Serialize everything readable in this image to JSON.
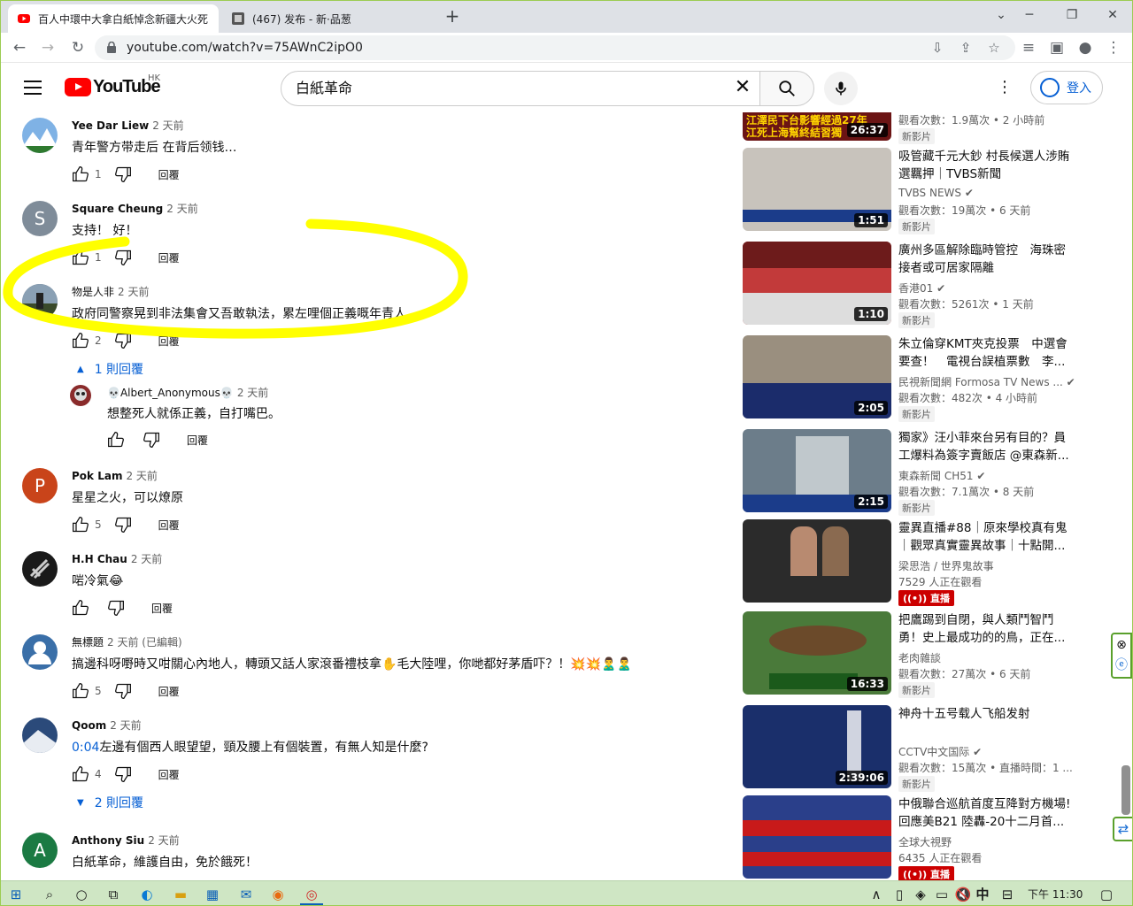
{
  "browser": {
    "tabs": [
      {
        "title": "百人中環中大拿白紙悼念新疆大火死",
        "close": "×"
      },
      {
        "title": "(467) 发布 - 新·品葱",
        "close": "×"
      }
    ],
    "new_tab": "+",
    "url": "youtube.com/watch?v=75AWnC2ipO0"
  },
  "yt": {
    "logo_text": "YouTube",
    "region": "HK",
    "search_query": "白紙革命",
    "signin_label": "登入"
  },
  "comments": [
    {
      "author": "Yee Dar Liew",
      "time": "2 天前",
      "text": "青年警方带走后 在背后领钱…",
      "likes": "1",
      "reply": "回覆",
      "avatar_color": "#7fb2e5"
    },
    {
      "author": "Square Cheung",
      "time": "2 天前",
      "text": "支持！ 好！",
      "likes": "1",
      "reply": "回覆",
      "avatar_letter": "S",
      "avatar_color": "#7f8c99"
    },
    {
      "author": "物是人非",
      "time": "2 天前",
      "text": "政府同警察晃到非法集會又吾敢執法，累左哩個正義嘅年青人。",
      "likes": "2",
      "reply": "回覆",
      "avatar_color": "#4f5f6f",
      "replies_label": "1 則回覆"
    },
    {
      "author": "💀Albert_Anonymous💀",
      "time": "2 天前",
      "text": "想整死人就係正義，自打嘴巴。",
      "likes": "",
      "reply": "回覆",
      "avatar_color": "#8a2b2b"
    },
    {
      "author": "Pok Lam",
      "time": "2 天前",
      "text": "星星之火，可以燎原",
      "likes": "5",
      "reply": "回覆",
      "avatar_letter": "P",
      "avatar_color": "#c9441a"
    },
    {
      "author": "H.H Chau",
      "time": "2 天前",
      "text": "啱冷氣😂",
      "likes": "",
      "reply": "回覆",
      "avatar_color": "#1a1a1a"
    },
    {
      "author": "無標題",
      "time": "2 天前 (已編輯)",
      "text": "搞邊科呀嘢時又咁關心內地人，轉頭又話人家滾番禮枝拿✋毛大陸哩，你哋都好茅盾吓？！💥💥🙎‍♂️🙎‍♂️",
      "likes": "5",
      "reply": "回覆",
      "avatar_color": "#3a6fa8"
    },
    {
      "author": "Qoom",
      "time": "2 天前",
      "timestamp_link": "0:04",
      "text": "左邊有個西人眼望望，頸及腰上有個裝置，有無人知是什麼?",
      "likes": "4",
      "reply": "回覆",
      "avatar_color": "#2b4a7a",
      "replies_label": "2 則回覆"
    },
    {
      "author": "Anthony Siu",
      "time": "2 天前",
      "text": "白紙革命，維護自由，免於餓死！",
      "likes": "",
      "reply": "回覆",
      "avatar_letter": "A",
      "avatar_color": "#1b7a43"
    }
  ],
  "sidebar": [
    {
      "title": "",
      "duration": "26:37",
      "views": "觀看次數：1.9萬次 • 2 小時前",
      "channel": "",
      "badge": "新影片",
      "thumb_text": "江澤民下台影響經過27年\n江死上海幫終結習獨",
      "thumb_color": "#6b1414"
    },
    {
      "title": "吸管藏千元大鈔 村長候選人涉賄選羈押｜TVBS新聞",
      "duration": "1:51",
      "channel": "TVBS NEWS",
      "views": "觀看次數：19萬次 • 6 天前",
      "badge": "新影片",
      "thumb_color": "#c8c3bc"
    },
    {
      "title": "廣州多區解除臨時管控　海珠密接者或可居家隔離",
      "duration": "1:10",
      "channel": "香港01",
      "views": "觀看次數：5261次 • 1 天前",
      "badge": "新影片",
      "thumb_color": "#c23a3a"
    },
    {
      "title": "朱立倫穿KMT夾克投票　中選會要查！　電視台誤植票數　李...",
      "duration": "2:05",
      "channel": "民視新聞網 Formosa TV News ...",
      "views": "觀看次數：482次 • 4 小時前",
      "badge": "新影片",
      "thumb_color": "#9a8f7f"
    },
    {
      "title": "獨家》汪小菲來台另有目的？員工爆料為簽字賣飯店 @東森新...",
      "duration": "2:15",
      "channel": "東森新聞 CH51",
      "views": "觀看次數：7.1萬次 • 8 天前",
      "badge": "新影片",
      "thumb_color": "#6c7d8a"
    },
    {
      "title": "靈異直播#88｜原來學校真有鬼｜觀眾真實靈異故事｜十點開...",
      "duration": "",
      "channel": "梁思浩 / 世界鬼故事",
      "views": "7529 人正在觀看",
      "live_label": "直播",
      "thumb_color": "#2b2b2b"
    },
    {
      "title": "把鷹踢到自閉，與人類鬥智鬥勇！史上最成功的的鳥，正在...",
      "duration": "16:33",
      "channel": "老肉雜談",
      "views": "觀看次數：27萬次 • 6 天前",
      "badge": "新影片",
      "thumb_color": "#4a7a3a"
    },
    {
      "title": "神舟十五号载人飞船发射",
      "duration": "2:39:06",
      "channel": "CCTV中文国际",
      "views": "觀看次數：15萬次 • 直播時間：1 ...",
      "badge": "新影片",
      "thumb_color": "#1a2f6b"
    },
    {
      "title": "中俄聯合巡航首度互降對方機場!回應美B21 陸轟-20十二月首...",
      "duration": "",
      "channel": "全球大視野",
      "views": "6435 人正在觀看",
      "live_label": "直播",
      "thumb_color": "#2a3f8a"
    }
  ],
  "taskbar": {
    "time": "下午 11:30",
    "ime": "中"
  }
}
